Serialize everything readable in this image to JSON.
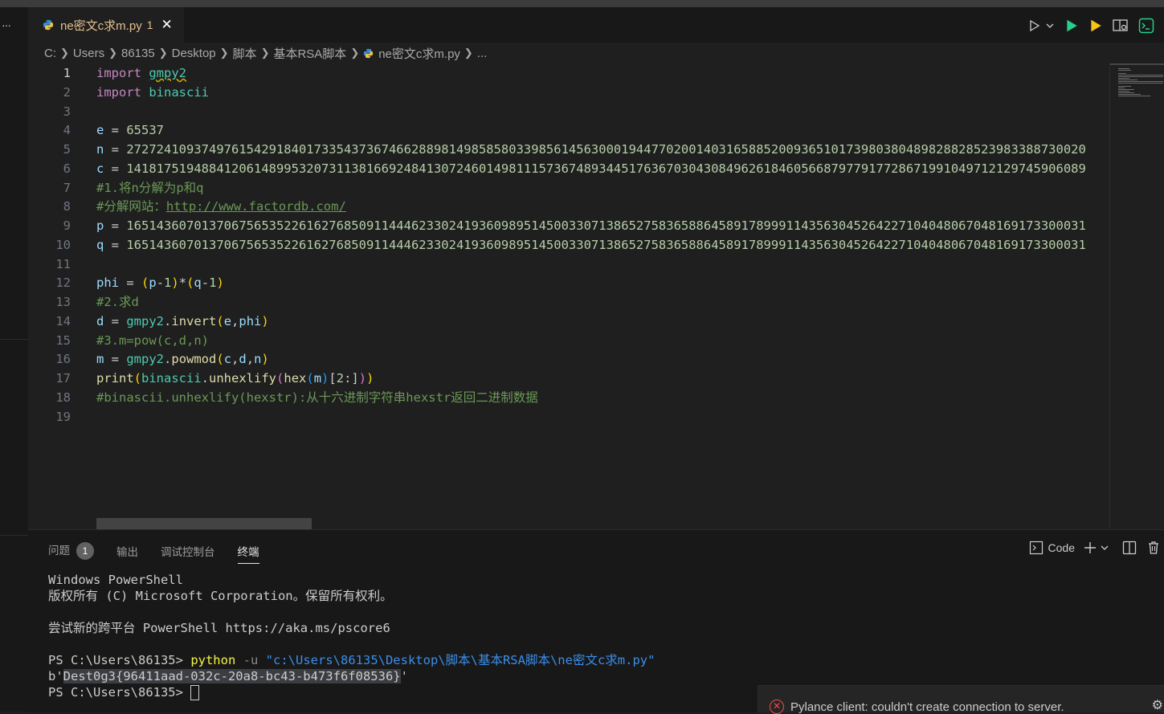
{
  "tab": {
    "filename": "ne密文c求m.py",
    "problem_count": "1"
  },
  "breadcrumb": [
    "C:",
    "Users",
    "86135",
    "Desktop",
    "脚本",
    "基本RSA脚本",
    "ne密文c求m.py",
    "..."
  ],
  "editor": {
    "current_line": 1,
    "lines": [
      {
        "n": "1"
      },
      {
        "n": "2"
      },
      {
        "n": "3"
      },
      {
        "n": "4"
      },
      {
        "n": "5"
      },
      {
        "n": "6"
      },
      {
        "n": "7"
      },
      {
        "n": "8"
      },
      {
        "n": "9"
      },
      {
        "n": "10"
      },
      {
        "n": "11"
      },
      {
        "n": "12"
      },
      {
        "n": "13"
      },
      {
        "n": "14"
      },
      {
        "n": "15"
      },
      {
        "n": "16"
      },
      {
        "n": "17"
      },
      {
        "n": "18"
      },
      {
        "n": "19"
      }
    ],
    "code": {
      "l1_kw": "import",
      "l1_mod": "gmpy2",
      "l2_kw": "import",
      "l2_mod": "binascii",
      "l4_var": "e",
      "l4_val": "65537",
      "l5_var": "n",
      "l5_val": "27272410937497615429184017335437367466288981498585803398561456300019447702001403165885200936510173980380489828828523983388730020",
      "l6_var": "c",
      "l6_val": "14181751948841206148995320731138166924841307246014981115736748934451763670304308496261846056687977917728671991049712129745906089",
      "l7": "#1.将n分解为p和q",
      "l8_prefix": "#分解网站：",
      "l8_link": "http://www.factordb.com/",
      "l9_var": "p",
      "l9_val": "16514360701370675653522616276850911444623302419360989514500330713865275836588645891789991143563045264227104048067048169173300031",
      "l10_var": "q",
      "l10_val": "16514360701370675653522616276850911444623302419360989514500330713865275836588645891789991143563045264227104048067048169173300031",
      "l13": "#2.求d",
      "l15": "#3.m=pow(c,d,n)",
      "l18": "#binascii.unhexlify(hexstr):从十六进制字符串hexstr返回二进制数据"
    }
  },
  "panel": {
    "tabs": [
      {
        "label": "问题",
        "badge": "1"
      },
      {
        "label": "输出"
      },
      {
        "label": "调试控制台"
      },
      {
        "label": "终端",
        "active": true
      }
    ],
    "shell_label": "Code",
    "terminal": {
      "line1": "Windows PowerShell",
      "line2": "版权所有 (C) Microsoft Corporation。保留所有权利。",
      "line3": "尝试新的跨平台 PowerShell https://aka.ms/pscore6",
      "prompt": "PS C:\\Users\\86135> ",
      "cmd": "python",
      "flag": "-u",
      "arg": "\"c:\\Users\\86135\\Desktop\\脚本\\基本RSA脚本\\ne密文c求m.py\"",
      "out_prefix": "b'",
      "out_flag": "Dest0g3{96411aad-032c-20a8-bc43-b473f6f08536}",
      "out_suffix": "'",
      "prompt2": "PS C:\\Users\\86135> "
    }
  },
  "notification": {
    "message": "Pylance client: couldn't create connection to server."
  },
  "colors": {
    "accent_green": "#23d18b",
    "run_yellow": "#f5c518",
    "error_red": "#f14c4c"
  }
}
